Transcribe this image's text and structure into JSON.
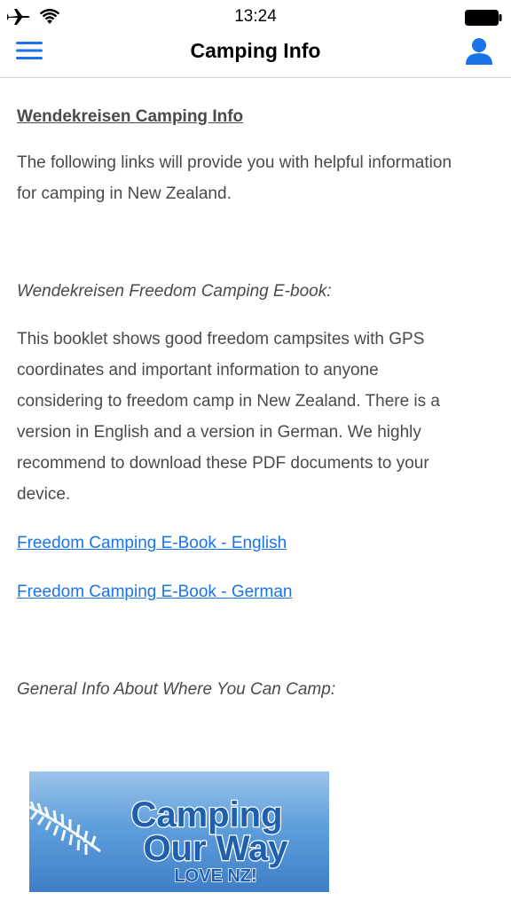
{
  "status_bar": {
    "time": "13:24",
    "icons": [
      "airplane-icon",
      "wifi-icon",
      "battery-icon"
    ]
  },
  "nav": {
    "title": "Camping Info",
    "left_icon": "menu-icon",
    "right_icon": "profile-icon",
    "accent_color": "#1a73e8"
  },
  "content": {
    "heading": "Wendekreisen Camping Info",
    "intro_line1": "The following links will provide you with helpful information",
    "intro_line2": "for camping in New Zealand.",
    "ebook_section_title": "Wendekreisen Freedom Camping E-book:",
    "ebook_desc_lines": [
      "This booklet shows good freedom campsites with GPS",
      "coordinates and important information to anyone",
      "considering to freedom camp in New Zealand. There is a",
      "version in English and a version in German. We highly",
      "recommend to download these PDF documents to your",
      "device."
    ],
    "link_english": "Freedom Camping E-Book - English",
    "link_german": "Freedom Camping E-Book - German",
    "general_info_title": "General Info About Where You Can Camp:",
    "banner": {
      "line1": "Camping",
      "line2": "Our Way",
      "line3": "LOVE NZ!"
    }
  }
}
